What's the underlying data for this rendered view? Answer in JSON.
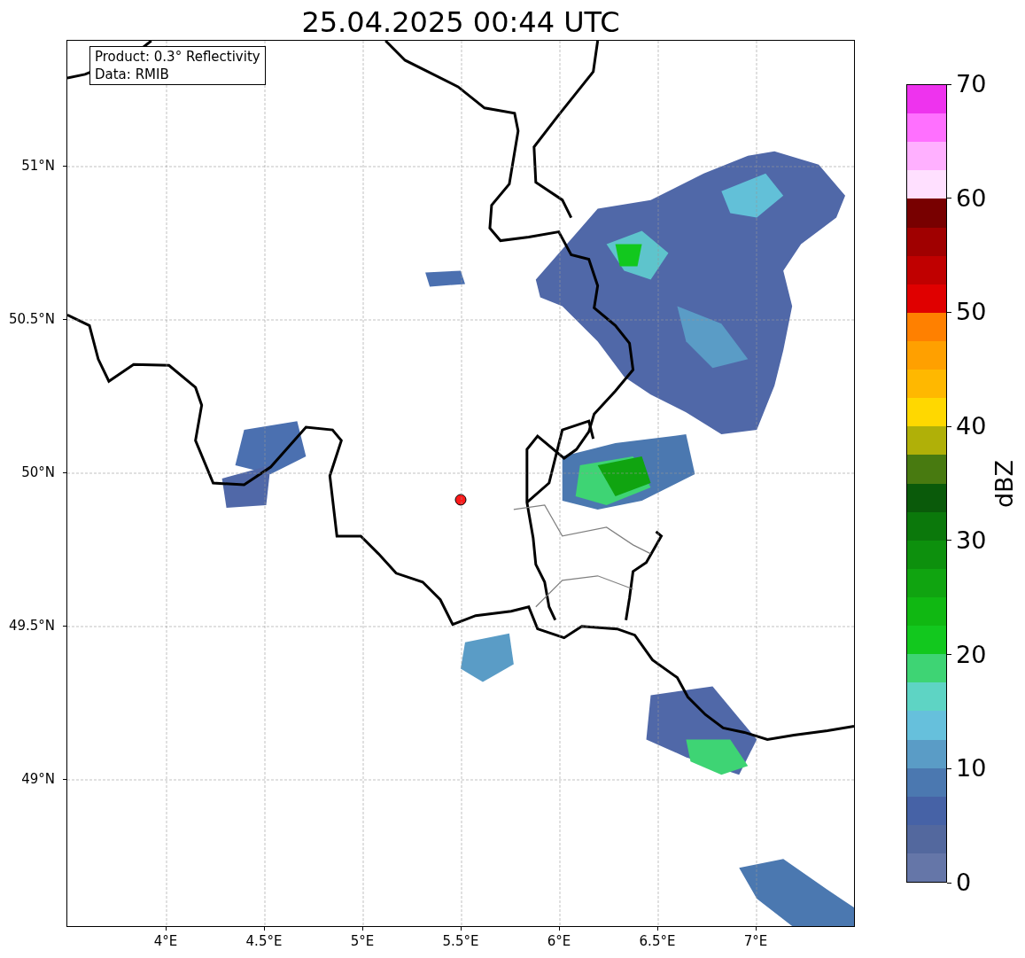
{
  "title": "25.04.2025 00:44 UTC",
  "info_box": [
    "Product: 0.3° Reflectivity",
    "Data: RMIB"
  ],
  "map": {
    "lat_ticks": [
      "51°N",
      "50.5°N",
      "50°N",
      "49.5°N",
      "49°N"
    ],
    "lon_ticks": [
      "4°E",
      "4.5°E",
      "5°E",
      "5.5°E",
      "6°E",
      "6.5°E",
      "7°E"
    ]
  },
  "colorbar": {
    "label": "dBZ",
    "ticks": [
      "70",
      "60",
      "50",
      "40",
      "30",
      "20",
      "10",
      "0"
    ],
    "bins": [
      {
        "color": "#ee33ee"
      },
      {
        "color": "#ff70ff"
      },
      {
        "color": "#ffb0ff"
      },
      {
        "color": "#ffe0ff"
      },
      {
        "color": "#780000"
      },
      {
        "color": "#a00000"
      },
      {
        "color": "#c00000"
      },
      {
        "color": "#e00000"
      },
      {
        "color": "#ff8000"
      },
      {
        "color": "#ffa000"
      },
      {
        "color": "#ffb800"
      },
      {
        "color": "#ffd800"
      },
      {
        "color": "#b0b008"
      },
      {
        "color": "#487a10"
      },
      {
        "color": "#0a5a0a"
      },
      {
        "color": "#0b780b"
      },
      {
        "color": "#0d900d"
      },
      {
        "color": "#10a410"
      },
      {
        "color": "#10b812"
      },
      {
        "color": "#12c81e"
      },
      {
        "color": "#3ed474"
      },
      {
        "color": "#5ed4c4"
      },
      {
        "color": "#66c0dc"
      },
      {
        "color": "#5a9cc6"
      },
      {
        "color": "#4b78b0"
      },
      {
        "color": "#4662a6"
      },
      {
        "color": "#53689e"
      },
      {
        "color": "#6576a8"
      }
    ]
  }
}
